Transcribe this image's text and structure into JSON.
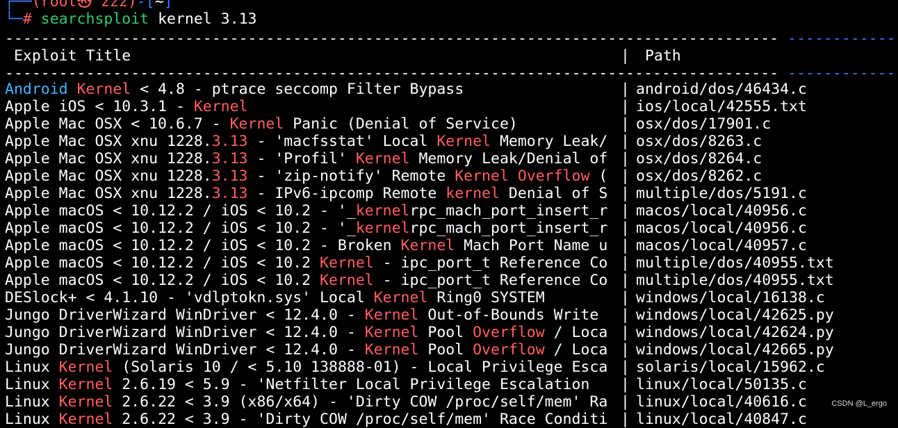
{
  "prompt": {
    "frame_top": "┌──",
    "user_host": "(root㉿ zzz)",
    "cwd_frame_open": "-[",
    "cwd": "~",
    "cwd_frame_close": "]",
    "frame_bottom": "└─",
    "hash": "# ",
    "command": "searchsploit",
    "args": " kernel 3.13"
  },
  "table": {
    "dashes_title": "--------------------------------------------------------------------------------------",
    "dashes_sep": " ",
    "dashes_path": "------------------------------",
    "header_title": " Exploit Title",
    "header_sep": "|",
    "header_path": " Path",
    "sep": "|",
    "rows": [
      {
        "segments": [
          {
            "t": "Android",
            "c": "android"
          },
          {
            "t": " "
          },
          {
            "t": "Kernel",
            "c": "hl"
          },
          {
            "t": " < 4.8 - ptrace seccomp Filter Bypass"
          }
        ],
        "path": "android/dos/46434.c"
      },
      {
        "segments": [
          {
            "t": "Apple iOS < 10.3.1 - "
          },
          {
            "t": "Kernel",
            "c": "hl"
          }
        ],
        "path": "ios/local/42555.txt"
      },
      {
        "segments": [
          {
            "t": "Apple Mac OSX < 10.6.7 - "
          },
          {
            "t": "Kernel",
            "c": "hl"
          },
          {
            "t": " Panic (Denial of Service)"
          }
        ],
        "path": "osx/dos/17901.c"
      },
      {
        "segments": [
          {
            "t": "Apple Mac OSX xnu 1228."
          },
          {
            "t": "3.13",
            "c": "hl"
          },
          {
            "t": " - 'macfsstat' Local "
          },
          {
            "t": "Kernel",
            "c": "hl"
          },
          {
            "t": " Memory Leak/"
          }
        ],
        "path": "osx/dos/8263.c"
      },
      {
        "segments": [
          {
            "t": "Apple Mac OSX xnu 1228."
          },
          {
            "t": "3.13",
            "c": "hl"
          },
          {
            "t": " - 'Profil' "
          },
          {
            "t": "Kernel",
            "c": "hl"
          },
          {
            "t": " Memory Leak/Denial of"
          }
        ],
        "path": "osx/dos/8264.c"
      },
      {
        "segments": [
          {
            "t": "Apple Mac OSX xnu 1228."
          },
          {
            "t": "3.13",
            "c": "hl"
          },
          {
            "t": " - 'zip-notify' Remote "
          },
          {
            "t": "Kernel",
            "c": "hl"
          },
          {
            "t": " "
          },
          {
            "t": "Overflow",
            "c": "hl"
          },
          {
            "t": " ("
          }
        ],
        "path": "osx/dos/8262.c"
      },
      {
        "segments": [
          {
            "t": "Apple Mac OSX xnu 1228."
          },
          {
            "t": "3.13",
            "c": "hl"
          },
          {
            "t": " - IPv6-ipcomp Remote "
          },
          {
            "t": "kernel",
            "c": "hl"
          },
          {
            "t": " Denial of S"
          }
        ],
        "path": "multiple/dos/5191.c"
      },
      {
        "segments": [
          {
            "t": "Apple macOS < 10.12.2 / iOS < 10.2 - '_"
          },
          {
            "t": "kernel",
            "c": "hl"
          },
          {
            "t": "rpc_mach_port_insert_r"
          }
        ],
        "path": "macos/local/40956.c"
      },
      {
        "segments": [
          {
            "t": "Apple macOS < 10.12.2 / iOS < 10.2 - '_"
          },
          {
            "t": "kernel",
            "c": "hl"
          },
          {
            "t": "rpc_mach_port_insert_r"
          }
        ],
        "path": "macos/local/40956.c"
      },
      {
        "segments": [
          {
            "t": "Apple macOS < 10.12.2 / iOS < 10.2 - Broken "
          },
          {
            "t": "Kernel",
            "c": "hl"
          },
          {
            "t": " Mach Port Name u"
          }
        ],
        "path": "macos/local/40957.c"
      },
      {
        "segments": [
          {
            "t": "Apple macOS < 10.12.2 / iOS < 10.2 "
          },
          {
            "t": "Kernel",
            "c": "hl"
          },
          {
            "t": " - ipc_port_t Reference Co"
          }
        ],
        "path": "multiple/dos/40955.txt"
      },
      {
        "segments": [
          {
            "t": "Apple macOS < 10.12.2 / iOS < 10.2 "
          },
          {
            "t": "Kernel",
            "c": "hl"
          },
          {
            "t": " - ipc_port_t Reference Co"
          }
        ],
        "path": "multiple/dos/40955.txt"
      },
      {
        "segments": [
          {
            "t": "DESlock+ < 4.1.10 - 'vdlptokn.sys' Local "
          },
          {
            "t": "Kernel",
            "c": "hl"
          },
          {
            "t": " Ring0 SYSTEM"
          }
        ],
        "path": "windows/local/16138.c"
      },
      {
        "segments": [
          {
            "t": "Jungo DriverWizard WinDriver < 12.4.0 - "
          },
          {
            "t": "Kernel",
            "c": "hl"
          },
          {
            "t": " Out-of-Bounds Write"
          }
        ],
        "path": "windows/local/42625.py"
      },
      {
        "segments": [
          {
            "t": "Jungo DriverWizard WinDriver < 12.4.0 - "
          },
          {
            "t": "Kernel",
            "c": "hl"
          },
          {
            "t": " Pool "
          },
          {
            "t": "Overflow",
            "c": "hl"
          },
          {
            "t": " / Loca"
          }
        ],
        "path": "windows/local/42624.py"
      },
      {
        "segments": [
          {
            "t": "Jungo DriverWizard WinDriver < 12.4.0 - "
          },
          {
            "t": "Kernel",
            "c": "hl"
          },
          {
            "t": " Pool "
          },
          {
            "t": "Overflow",
            "c": "hl"
          },
          {
            "t": " / Loca"
          }
        ],
        "path": "windows/local/42665.py"
      },
      {
        "segments": [
          {
            "t": "Linux "
          },
          {
            "t": "Kernel",
            "c": "hl"
          },
          {
            "t": " (Solaris 10 / < 5.10 138888-01) - Local Privilege Esca"
          }
        ],
        "path": "solaris/local/15962.c"
      },
      {
        "segments": [
          {
            "t": "Linux "
          },
          {
            "t": "Kernel",
            "c": "hl"
          },
          {
            "t": " 2.6.19 < 5.9 - 'Netfilter Local Privilege Escalation"
          }
        ],
        "path": "linux/local/50135.c"
      },
      {
        "segments": [
          {
            "t": "Linux "
          },
          {
            "t": "Kernel",
            "c": "hl"
          },
          {
            "t": " 2.6.22 < 3.9 (x86/x64) - 'Dirty COW /proc/self/mem' Ra"
          }
        ],
        "path": "linux/local/40616.c"
      },
      {
        "segments": [
          {
            "t": "Linux "
          },
          {
            "t": "Kernel",
            "c": "hl"
          },
          {
            "t": " 2.6.22 < 3.9 - 'Dirty COW /proc/self/mem' Race Conditi"
          }
        ],
        "path": "linux/local/40847.c"
      }
    ]
  },
  "watermark": "CSDN @L_ergo",
  "colors": {
    "background": "#000000",
    "highlight": "#ff5f5f",
    "android": "#3fb6ff",
    "command": "#2ecc71",
    "frame": "#3b78ff"
  }
}
